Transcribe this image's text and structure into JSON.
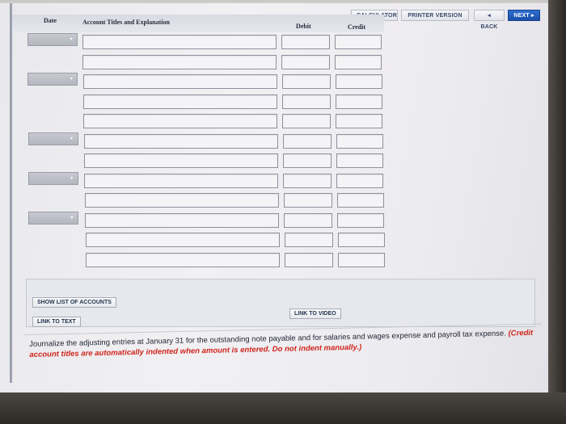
{
  "toolbar": {
    "calculator": "CALCULATOR",
    "printer_version": "PRINTER VERSION",
    "back": "◂ BACK",
    "next": "NEXT ▸"
  },
  "table": {
    "headers": {
      "date": "Date",
      "account": "Account Titles and Explanation",
      "debit": "Debit",
      "credit": "Credit"
    },
    "rows": [
      {
        "date_select": true,
        "account": "",
        "debit": "",
        "credit": ""
      },
      {
        "date_select": false,
        "account": "",
        "debit": "",
        "credit": ""
      },
      {
        "date_select": true,
        "account": "",
        "debit": "",
        "credit": ""
      },
      {
        "date_select": false,
        "account": "",
        "debit": "",
        "credit": ""
      },
      {
        "date_select": false,
        "account": "",
        "debit": "",
        "credit": ""
      },
      {
        "date_select": true,
        "account": "",
        "debit": "",
        "credit": ""
      },
      {
        "date_select": false,
        "account": "",
        "debit": "",
        "credit": ""
      },
      {
        "date_select": true,
        "account": "",
        "debit": "",
        "credit": ""
      },
      {
        "date_select": false,
        "account": "",
        "debit": "",
        "credit": ""
      },
      {
        "date_select": true,
        "account": "",
        "debit": "",
        "credit": ""
      },
      {
        "date_select": false,
        "account": "",
        "debit": "",
        "credit": ""
      },
      {
        "date_select": false,
        "account": "",
        "debit": "",
        "credit": ""
      }
    ]
  },
  "links": {
    "show_accounts": "SHOW LIST OF ACCOUNTS",
    "link_to_video": "LINK TO VIDEO",
    "link_to_text": "LINK TO TEXT"
  },
  "instructions": {
    "main": "Journalize the adjusting entries at January 31 for the outstanding note payable and for salaries and wages expense and payroll tax expense.",
    "note": "(Credit account titles are automatically indented when amount is entered. Do not indent manually.)"
  },
  "colors": {
    "primary_button": "#1b4fa8",
    "note_red": "#d0241c"
  }
}
